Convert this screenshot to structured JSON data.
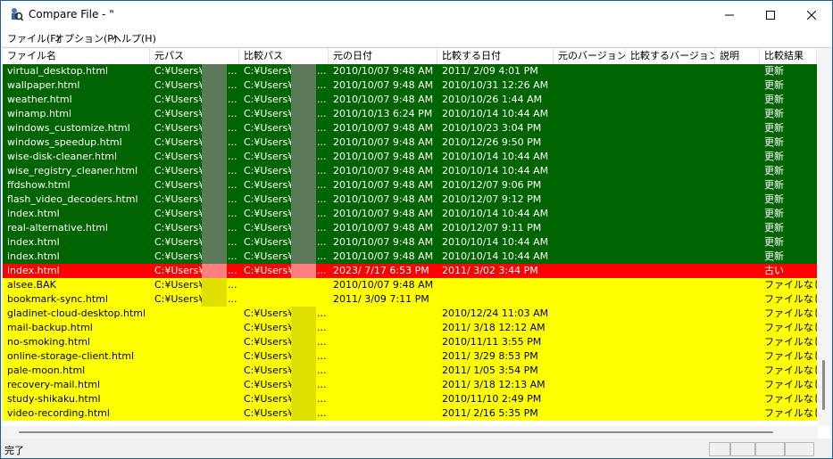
{
  "window": {
    "title": "Compare File - \"",
    "controls": {
      "minimize": "minimize",
      "maximize": "maximize",
      "close": "close"
    }
  },
  "menu": [
    "ファイル(F)",
    "オプション(P)",
    "ヘルプ(H)"
  ],
  "columns": [
    "ファイル名",
    "元パス",
    "比較パス",
    "元の日付",
    "比較する日付",
    "元のバージョン",
    "比較するバージョン",
    "説明",
    "比較結果"
  ],
  "rows": [
    {
      "status": "updated",
      "name": "virtual_desktop.html",
      "src": "C:¥Users¥",
      "cmp": "C:¥Users¥",
      "src_date": "2010/10/07 9:48 AM",
      "cmp_date": "2011/ 2/09 4:01 PM",
      "result": "更新"
    },
    {
      "status": "updated",
      "name": "wallpaper.html",
      "src": "C:¥Users¥",
      "cmp": "C:¥Users¥",
      "src_date": "2010/10/07 9:48 AM",
      "cmp_date": "2010/10/31 12:26 AM",
      "result": "更新"
    },
    {
      "status": "updated",
      "name": "weather.html",
      "src": "C:¥Users¥",
      "cmp": "C:¥Users¥",
      "src_date": "2010/10/07 9:48 AM",
      "cmp_date": "2010/10/26 1:44 AM",
      "result": "更新"
    },
    {
      "status": "updated",
      "name": "winamp.html",
      "src": "C:¥Users¥",
      "cmp": "C:¥Users¥",
      "src_date": "2010/10/13 6:24 PM",
      "cmp_date": "2010/10/14 10:44 AM",
      "result": "更新"
    },
    {
      "status": "updated",
      "name": "windows_customize.html",
      "src": "C:¥Users¥",
      "cmp": "C:¥Users¥",
      "src_date": "2010/10/07 9:48 AM",
      "cmp_date": "2010/10/23 3:04 PM",
      "result": "更新"
    },
    {
      "status": "updated",
      "name": "windows_speedup.html",
      "src": "C:¥Users¥",
      "cmp": "C:¥Users¥",
      "src_date": "2010/10/07 9:48 AM",
      "cmp_date": "2010/12/26 9:50 PM",
      "result": "更新"
    },
    {
      "status": "updated",
      "name": "wise-disk-cleaner.html",
      "src": "C:¥Users¥",
      "cmp": "C:¥Users¥",
      "src_date": "2010/10/07 9:48 AM",
      "cmp_date": "2010/10/14 10:44 AM",
      "result": "更新"
    },
    {
      "status": "updated",
      "name": "wise_registry_cleaner.html",
      "src": "C:¥Users¥",
      "cmp": "C:¥Users¥",
      "src_date": "2010/10/07 9:48 AM",
      "cmp_date": "2010/10/14 10:44 AM",
      "result": "更新"
    },
    {
      "status": "updated",
      "name": "ffdshow.html",
      "src": "C:¥Users¥",
      "cmp": "C:¥Users¥",
      "src_date": "2010/10/07 9:48 AM",
      "cmp_date": "2010/12/07 9:06 PM",
      "result": "更新"
    },
    {
      "status": "updated",
      "name": "flash_video_decoders.html",
      "src": "C:¥Users¥",
      "cmp": "C:¥Users¥",
      "src_date": "2010/10/07 9:48 AM",
      "cmp_date": "2010/12/07 9:12 PM",
      "result": "更新"
    },
    {
      "status": "updated",
      "name": "index.html",
      "src": "C:¥Users¥",
      "cmp": "C:¥Users¥",
      "src_date": "2010/10/07 9:48 AM",
      "cmp_date": "2010/10/14 10:44 AM",
      "result": "更新"
    },
    {
      "status": "updated",
      "name": "real-alternative.html",
      "src": "C:¥Users¥",
      "cmp": "C:¥Users¥",
      "src_date": "2010/10/07 9:48 AM",
      "cmp_date": "2010/12/07 9:11 PM",
      "result": "更新"
    },
    {
      "status": "updated",
      "name": "index.html",
      "src": "C:¥Users¥",
      "cmp": "C:¥Users¥",
      "src_date": "2010/10/07 9:48 AM",
      "cmp_date": "2010/10/14 10:44 AM",
      "result": "更新"
    },
    {
      "status": "updated",
      "name": "index.html",
      "src": "C:¥Users¥",
      "cmp": "C:¥Users¥",
      "src_date": "2010/10/07 9:48 AM",
      "cmp_date": "2010/10/14 10:44 AM",
      "result": "更新"
    },
    {
      "status": "older",
      "name": "index.html",
      "src": "C:¥Users¥",
      "cmp": "C:¥Users¥",
      "src_date": "2023/ 7/17 6:53 PM",
      "cmp_date": "2011/ 3/02 3:44 PM",
      "result": "古い"
    },
    {
      "status": "missing",
      "name": "alsee.BAK",
      "src": "C:¥Users¥",
      "cmp": "",
      "src_date": "2010/10/07 9:48 AM",
      "cmp_date": "",
      "result": "ファイルなし"
    },
    {
      "status": "missing",
      "name": "bookmark-sync.html",
      "src": "C:¥Users¥",
      "cmp": "",
      "src_date": "2011/ 3/09 7:11 PM",
      "cmp_date": "",
      "result": "ファイルなし"
    },
    {
      "status": "missing",
      "name": "gladinet-cloud-desktop.html",
      "src": "",
      "cmp": "C:¥Users¥",
      "src_date": "",
      "cmp_date": "2010/12/24 11:03 AM",
      "result": "ファイルなし"
    },
    {
      "status": "missing",
      "name": "mail-backup.html",
      "src": "",
      "cmp": "C:¥Users¥",
      "src_date": "",
      "cmp_date": "2011/ 3/18 12:12 AM",
      "result": "ファイルなし"
    },
    {
      "status": "missing",
      "name": "no-smoking.html",
      "src": "",
      "cmp": "C:¥Users¥",
      "src_date": "",
      "cmp_date": "2010/11/11 3:55 PM",
      "result": "ファイルなし"
    },
    {
      "status": "missing",
      "name": "online-storage-client.html",
      "src": "",
      "cmp": "C:¥Users¥",
      "src_date": "",
      "cmp_date": "2011/ 3/29 8:53 PM",
      "result": "ファイルなし"
    },
    {
      "status": "missing",
      "name": "pale-moon.html",
      "src": "",
      "cmp": "C:¥Users¥",
      "src_date": "",
      "cmp_date": "2011/ 1/05 3:54 PM",
      "result": "ファイルなし"
    },
    {
      "status": "missing",
      "name": "recovery-mail.html",
      "src": "",
      "cmp": "C:¥Users¥",
      "src_date": "",
      "cmp_date": "2011/ 3/18 12:13 AM",
      "result": "ファイルなし"
    },
    {
      "status": "missing",
      "name": "study-shikaku.html",
      "src": "",
      "cmp": "C:¥Users¥",
      "src_date": "",
      "cmp_date": "2010/11/10 2:49 PM",
      "result": "ファイルなし"
    },
    {
      "status": "missing",
      "name": "video-recording.html",
      "src": "",
      "cmp": "C:¥Users¥",
      "src_date": "",
      "cmp_date": "2011/ 2/16 5:35 PM",
      "result": "ファイルなし"
    }
  ],
  "truncation": "...",
  "status": "完了",
  "colors": {
    "updated": "#006400",
    "older": "#ff0000",
    "missing": "#ffff00"
  }
}
